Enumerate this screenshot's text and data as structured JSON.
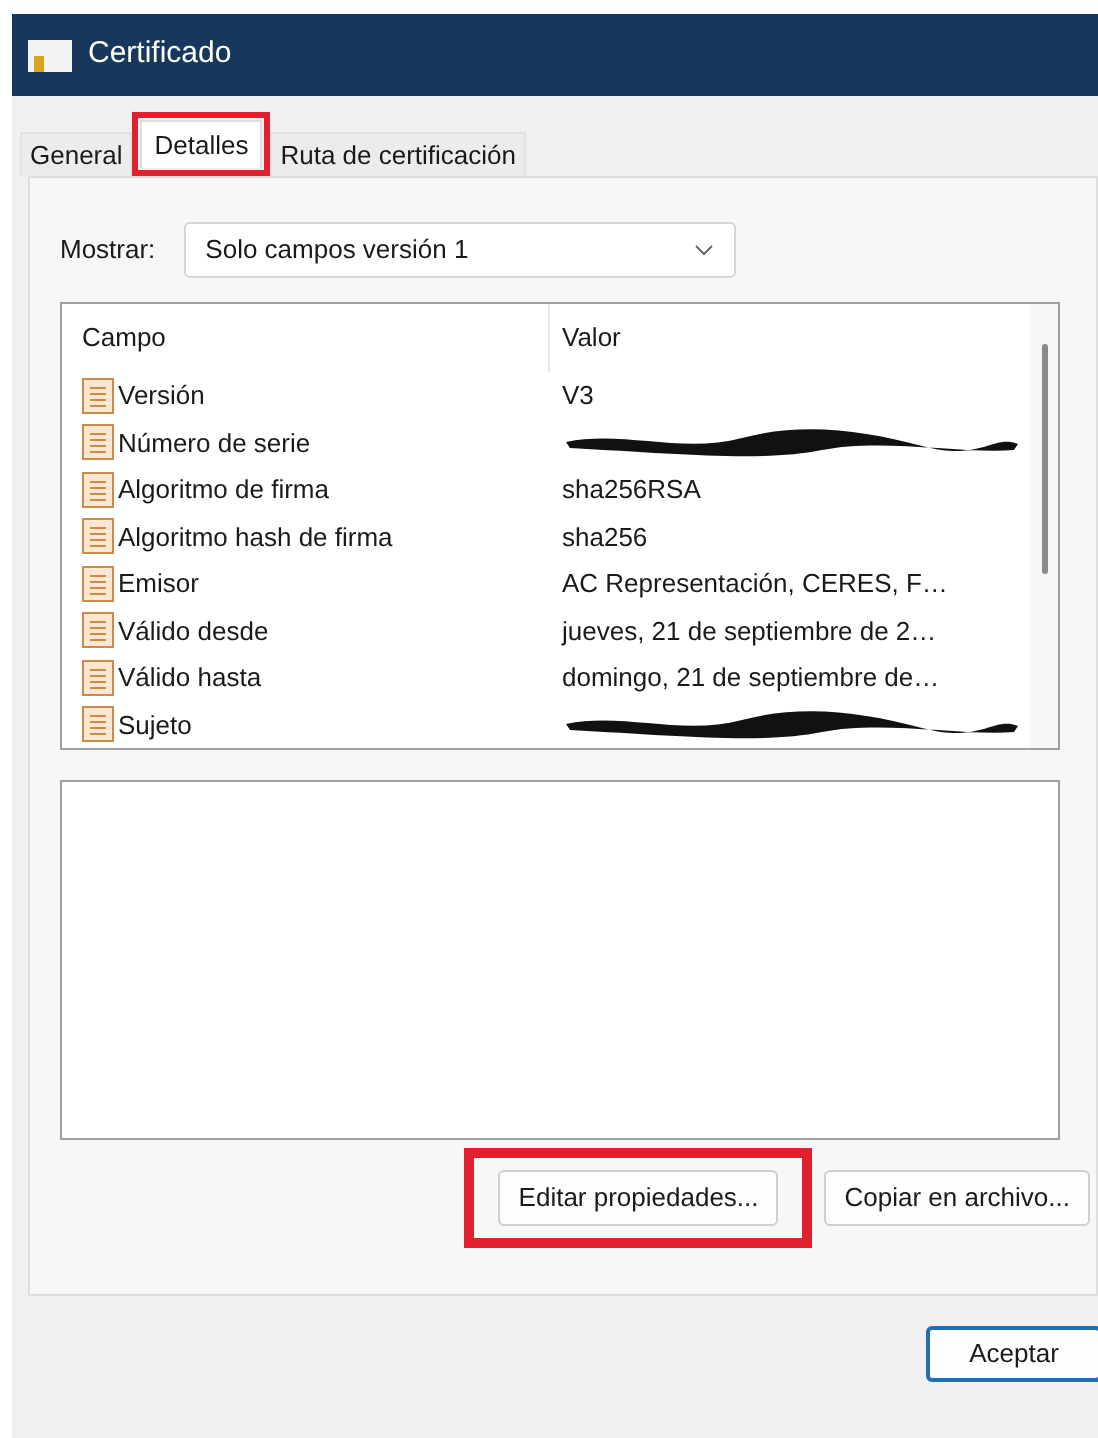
{
  "window": {
    "title": "Certificado"
  },
  "tabs": [
    {
      "label": "General",
      "selected": false,
      "highlighted": false
    },
    {
      "label": "Detalles",
      "selected": true,
      "highlighted": true
    },
    {
      "label": "Ruta de certificación",
      "selected": false,
      "highlighted": false
    }
  ],
  "show": {
    "label": "Mostrar:",
    "value": "Solo campos versión 1"
  },
  "table": {
    "columns": [
      "Campo",
      "Valor"
    ],
    "rows": [
      {
        "field": "Versión",
        "value": "V3",
        "kind": "text"
      },
      {
        "field": "Número de serie",
        "kind": "redacted"
      },
      {
        "field": "Algoritmo de firma",
        "value": "sha256RSA",
        "kind": "text"
      },
      {
        "field": "Algoritmo hash de firma",
        "value": "sha256",
        "kind": "text"
      },
      {
        "field": "Emisor",
        "value": "AC Representación, CERES, F…",
        "kind": "text"
      },
      {
        "field": "Válido desde",
        "value": "jueves, 21 de septiembre de 2…",
        "kind": "text"
      },
      {
        "field": "Válido hasta",
        "value": "domingo, 21 de septiembre de…",
        "kind": "text"
      },
      {
        "field": "Sujeto",
        "kind": "redacted"
      }
    ]
  },
  "buttons": [
    {
      "label": "Editar propiedades...",
      "highlighted": true
    },
    {
      "label": "Copiar en archivo...",
      "highlighted": false
    }
  ],
  "footer_button": "Aceptar"
}
